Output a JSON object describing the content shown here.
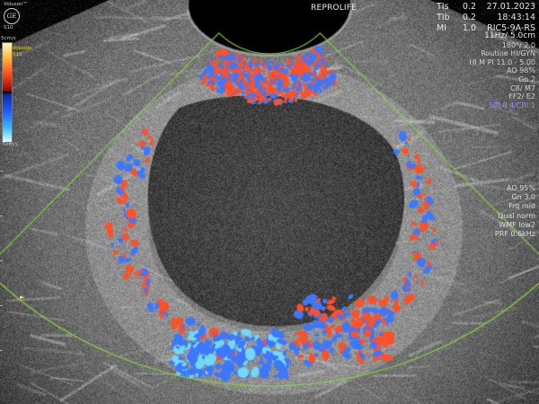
{
  "header": {
    "brand": "Voluson™",
    "logo_text": "GE",
    "model": "S10",
    "site": "REPROLIFE",
    "indices": [
      {
        "label": "TIs",
        "value": "0.2"
      },
      {
        "label": "TIb",
        "value": "0.2"
      },
      {
        "label": "MI",
        "value": "1.0"
      }
    ],
    "date": "27.01.2023",
    "time": "18:43:14",
    "probe": "RIC5-9A-RS"
  },
  "bmode_params": [
    "11Hz/ 5.0cm",
    "180°/ 2.0",
    "Routine HI/GYN",
    "HI M PI 11.0 - 5.00",
    "AO 98%",
    "Gn 2",
    "C8/ M7",
    "FF2/ E2"
  ],
  "srl_line": "SRI II 4/CRI 1",
  "color_params": [
    "AO 95%",
    "Gn 3.0",
    "Frq mid",
    "Qual norm",
    "WMF low2",
    "PRF 0.6kHz"
  ],
  "color_scale": {
    "top_label": "5cm/s",
    "bottom_label": "-5cm/s",
    "tag1": "Voluson",
    "tag2": "S10"
  },
  "colors": {
    "sector_outline": "#86d13c",
    "doppler_red": "#ff5028",
    "doppler_blue": "#3c78ff",
    "cursor": "#37d037",
    "info_blue": "#8e8eff"
  },
  "icons": [
    "ge-logo-icon",
    "side-marker-icon",
    "cursor-cross-icon"
  ]
}
